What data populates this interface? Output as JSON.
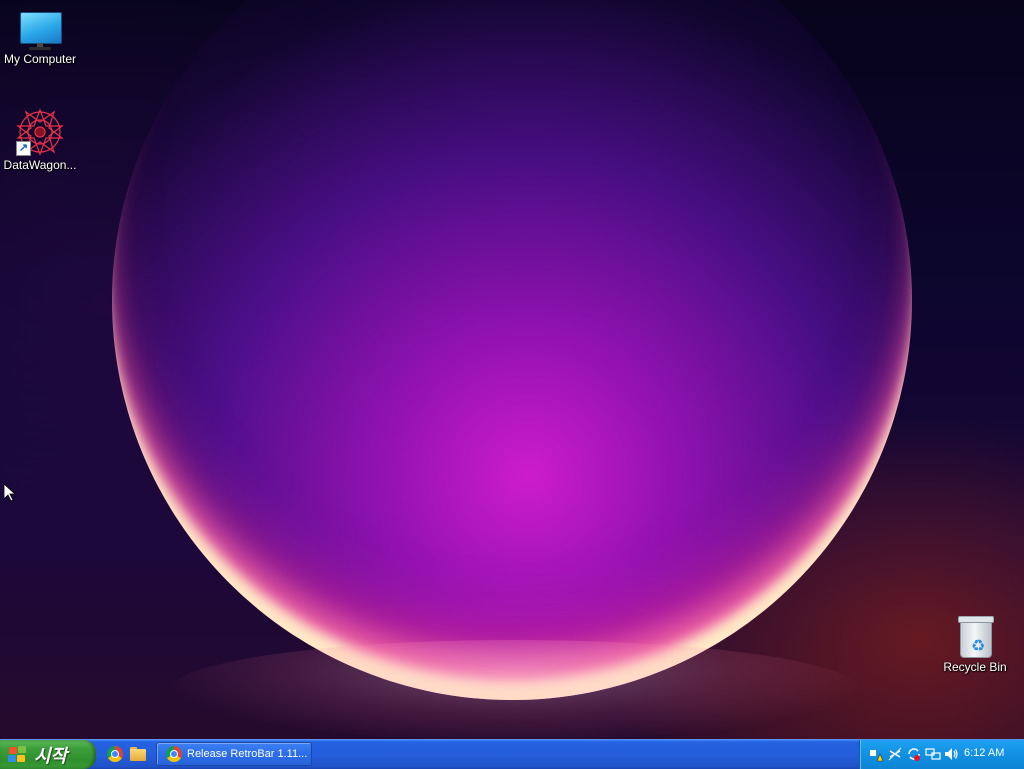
{
  "desktop": {
    "icons": [
      {
        "label": "My Computer",
        "icon": "monitor-icon"
      },
      {
        "label": "DataWagon...",
        "icon": "datawagon-icon",
        "shortcut": true
      },
      {
        "label": "Recycle Bin",
        "icon": "recycle-bin-icon"
      }
    ]
  },
  "taskbar": {
    "start_label": "시작",
    "quick_launch": [
      {
        "name": "Google Chrome",
        "icon": "chrome-icon"
      },
      {
        "name": "File Explorer",
        "icon": "folder-icon"
      }
    ],
    "task_button": {
      "label": "Release RetroBar 1.11...",
      "icon": "chrome-icon"
    },
    "tray": {
      "icons": [
        "network-warning-icon",
        "bluetooth-icon",
        "sync-icon",
        "network-icon",
        "volume-icon"
      ],
      "clock": "6:12 AM"
    }
  },
  "colors": {
    "taskbar": "#245edb",
    "start_button": "#3c9e3a",
    "tray": "#1290e2"
  }
}
